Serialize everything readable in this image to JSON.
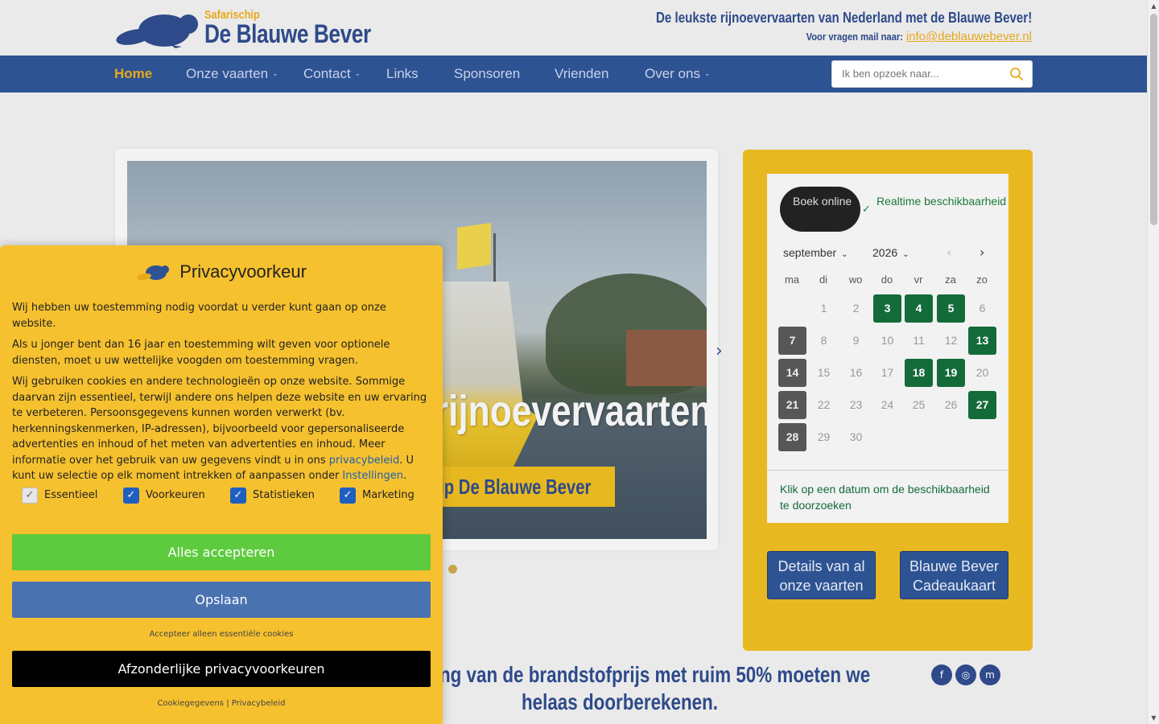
{
  "header": {
    "logo_sub": "Safarischip",
    "logo_title": "De Blauwe Bever",
    "tagline": "De leukste rijnoevervaarten van Nederland met de Blauwe Bever!",
    "contact_label": "Voor vragen mail naar:",
    "contact_email": "info@deblauwebever.nl"
  },
  "nav": {
    "items": [
      {
        "label": "Home"
      },
      {
        "label": "Onze vaarten"
      },
      {
        "label": "Contact"
      },
      {
        "label": "Links"
      },
      {
        "label": "Sponsoren"
      },
      {
        "label": "Vrienden"
      },
      {
        "label": "Over ons"
      }
    ],
    "search_placeholder": "Ik ben opzoek naar..."
  },
  "hero": {
    "title": "De leukste rijnoevervaarten!",
    "banner": "Safarischip De Blauwe Bever"
  },
  "booking": {
    "book_label": "Boek online",
    "realtime_label": "Realtime beschikbaarheid",
    "month": "september",
    "year": "2026",
    "weekdays": [
      "ma",
      "di",
      "wo",
      "do",
      "vr",
      "za",
      "zo"
    ],
    "days": [
      "1",
      "2",
      "3",
      "4",
      "5",
      "6",
      "7",
      "8",
      "9",
      "10",
      "11",
      "12",
      "13",
      "14",
      "15",
      "16",
      "17",
      "18",
      "19",
      "20",
      "21",
      "22",
      "23",
      "24",
      "25",
      "26",
      "27",
      "28",
      "29",
      "30"
    ],
    "available_days": [
      3,
      4,
      5,
      13,
      18,
      19,
      27
    ],
    "past_days": [
      7,
      14,
      21,
      28
    ],
    "hint": "Klik op een datum om de beschikbaarheid te doorzoeken",
    "details_button": "Details van al onze vaarten",
    "giftcard_button": "Blauwe Bever Cadeaukaart"
  },
  "bottom": {
    "heading": "De stijging van de brandstofprijs met ruim 50% moeten we helaas doorberekenen."
  },
  "privacy": {
    "title": "Privacyvoorkeur",
    "p1": "Wij hebben uw toestemming nodig voordat u verder kunt gaan op onze website.",
    "p2": "Als u jonger bent dan 16 jaar en toestemming wilt geven voor optionele diensten, moet u uw wettelijke voogden om toestemming vragen.",
    "p3_a": "Wij gebruiken cookies en andere technologieën op onze website. Sommige daarvan zijn essentieel, terwijl andere ons helpen deze website en uw ervaring te verbeteren. Persoonsgegevens kunnen worden verwerkt (bv. herkenningskenmerken, IP-adressen), bijvoorbeeld voor gepersonaliseerde advertenties en inhoud of het meten van advertenties en inhoud. Meer informatie over het gebruik van uw gegevens vindt u in ons ",
    "p3_link1": "privacybeleid",
    "p3_b": ". U kunt uw selectie op elk moment intrekken of aanpassen onder ",
    "p3_link2": "Instellingen",
    "p3_c": ".",
    "checkboxes": [
      {
        "label": "Essentieel",
        "checked": true,
        "locked": true
      },
      {
        "label": "Voorkeuren",
        "checked": true
      },
      {
        "label": "Statistieken",
        "checked": true
      },
      {
        "label": "Marketing",
        "checked": true
      }
    ],
    "accept_all": "Alles accepteren",
    "save": "Opslaan",
    "accept_essential": "Accepteer alleen essentiële cookies",
    "individual": "Afzonderlijke privacyvoorkeuren",
    "footer_link1": "Cookiegegevens",
    "footer_sep": "|",
    "footer_link2": "Privacybeleid"
  },
  "colors": {
    "brand_blue": "#2e5393",
    "brand_yellow": "#e8b820",
    "available_green": "#136b3a",
    "accept_green": "#5ecb3e"
  }
}
